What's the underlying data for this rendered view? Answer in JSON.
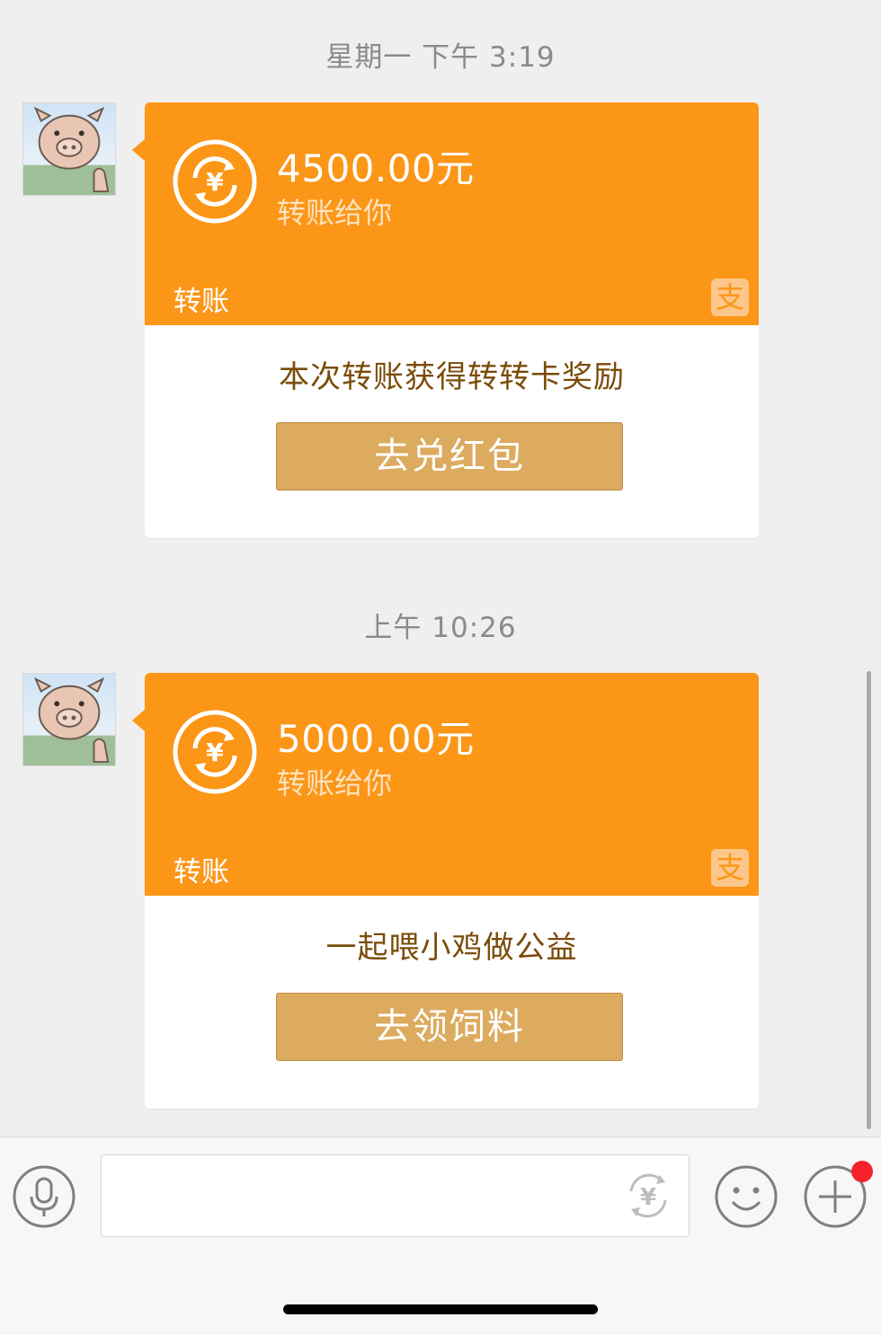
{
  "timestamps": [
    "星期一 下午 3:19",
    "上午 10:26"
  ],
  "messages": [
    {
      "amount": "4500.00元",
      "subtitle": "转账给你",
      "type_label": "转账",
      "badge_icon": "alipay-logo",
      "badge_glyph": "支",
      "promo_text": "本次转账获得转转卡奖励",
      "action_label": "去兑红包"
    },
    {
      "amount": "5000.00元",
      "subtitle": "转账给你",
      "type_label": "转账",
      "badge_icon": "alipay-logo",
      "badge_glyph": "支",
      "promo_text": "一起喂小鸡做公益",
      "action_label": "去领饲料"
    }
  ],
  "input_bar": {
    "voice_icon": "microphone-icon",
    "transfer_icon": "yuan-transfer-icon",
    "emoji_icon": "smiley-icon",
    "more_icon": "plus-icon",
    "notification_dot_color": "#f5222d"
  },
  "colors": {
    "card_orange": "#fb9617",
    "button_gold": "#dcab5f",
    "background": "#efefef"
  }
}
